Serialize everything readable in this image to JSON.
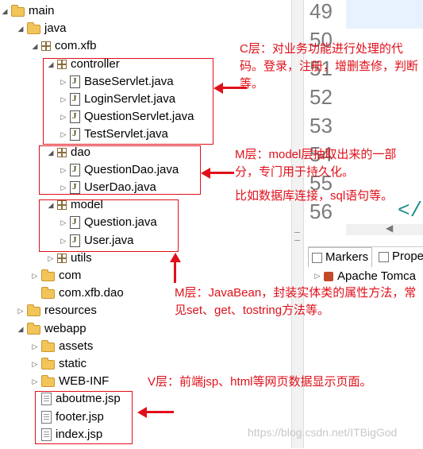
{
  "tree": {
    "rows": [
      {
        "label": "main",
        "icon": "folder-icon",
        "twisty": "expanded"
      },
      {
        "label": "java",
        "icon": "folder-icon",
        "twisty": "expanded"
      },
      {
        "label": "com.xfb",
        "icon": "package-icon",
        "twisty": "expanded"
      },
      {
        "label": "controller",
        "icon": "package-icon",
        "twisty": "expanded"
      },
      {
        "label": "BaseServlet.java",
        "icon": "java-file-icon",
        "twisty": "collapsed"
      },
      {
        "label": "LoginServlet.java",
        "icon": "java-file-icon",
        "twisty": "collapsed"
      },
      {
        "label": "QuestionServlet.java",
        "icon": "java-file-icon",
        "twisty": "collapsed"
      },
      {
        "label": "TestServlet.java",
        "icon": "java-file-icon",
        "twisty": "collapsed"
      },
      {
        "label": "dao",
        "icon": "package-icon",
        "twisty": "expanded"
      },
      {
        "label": "QuestionDao.java",
        "icon": "java-file-icon",
        "twisty": "collapsed"
      },
      {
        "label": "UserDao.java",
        "icon": "java-file-icon",
        "twisty": "collapsed"
      },
      {
        "label": "model",
        "icon": "package-icon",
        "twisty": "expanded"
      },
      {
        "label": "Question.java",
        "icon": "java-file-icon",
        "twisty": "collapsed"
      },
      {
        "label": "User.java",
        "icon": "java-file-icon",
        "twisty": "collapsed"
      },
      {
        "label": "utils",
        "icon": "package-icon",
        "twisty": "collapsed"
      },
      {
        "label": "com",
        "icon": "folder-icon",
        "twisty": "collapsed"
      },
      {
        "label": "com.xfb.dao",
        "icon": "folder-icon",
        "twisty": "none"
      },
      {
        "label": "resources",
        "icon": "folder-icon",
        "twisty": "collapsed"
      },
      {
        "label": "webapp",
        "icon": "folder-icon",
        "twisty": "expanded"
      },
      {
        "label": "assets",
        "icon": "folder-icon",
        "twisty": "collapsed"
      },
      {
        "label": "static",
        "icon": "folder-icon",
        "twisty": "collapsed"
      },
      {
        "label": "WEB-INF",
        "icon": "folder-icon",
        "twisty": "collapsed"
      },
      {
        "label": "aboutme.jsp",
        "icon": "jsp-file-icon",
        "twisty": "none"
      },
      {
        "label": "footer.jsp",
        "icon": "jsp-file-icon",
        "twisty": "none"
      },
      {
        "label": "index.jsp",
        "icon": "jsp-file-icon",
        "twisty": "none"
      }
    ]
  },
  "editor": {
    "line_numbers": [
      "49",
      "50",
      "51",
      "52",
      "53",
      "54",
      "55",
      "56"
    ],
    "code_fragment": "</"
  },
  "views": {
    "tabs": [
      "Markers",
      "Prope"
    ],
    "server_item": "Apache Tomca"
  },
  "annotations": {
    "c_layer": "C层：对业务功能进行处理的代码。登录，注册，增删查修，判断等。",
    "m_layer_dao_1": "M层：model层抽取出来的一部分，专门用于持久化。",
    "m_layer_dao_2": "比如数据库连接，sql语句等。",
    "m_layer_model": "M层：JavaBean，封装实体类的属性方法，常见set、get、tostring方法等。",
    "v_layer": "V层：前端jsp、html等网页数据显示页面。"
  },
  "watermark": "https://blog.csdn.net/ITBigGod",
  "colors": {
    "annotation_red": "#e0101a",
    "line_number_gray": "#7b7b7b",
    "highlight": "#e8f2fe"
  }
}
